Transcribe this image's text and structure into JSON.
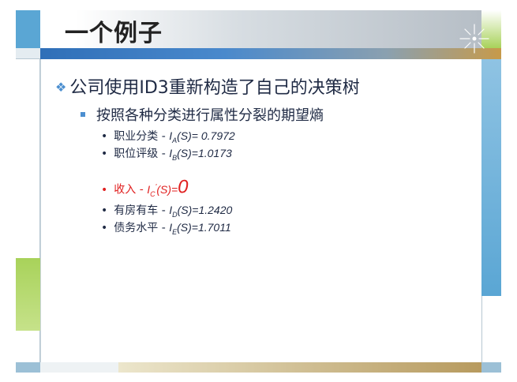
{
  "slide": {
    "title": "一个例子",
    "bullet_1": "公司使用ID3重新构造了自己的决策树",
    "bullet_2": "按照各种分类进行属性分裂的期望熵",
    "items": [
      {
        "label": "职业分类 - ",
        "func": "I",
        "sub": "A",
        "rest": "(S)= 0.7972"
      },
      {
        "label": "职位评级 - ",
        "func": "I",
        "sub": "B",
        "rest": "(S)=1.0173"
      },
      {
        "label": "收入 - ",
        "func": "I",
        "sub": "C",
        "sup": "'",
        "rest": "(S)=",
        "value": "0"
      },
      {
        "label": "有房有车 - ",
        "func": "I",
        "sub": "D",
        "rest": "(S)=1.2420"
      },
      {
        "label": "债务水平 - ",
        "func": "I",
        "sub": "E",
        "rest": "(S)=1.7011"
      }
    ]
  },
  "colors": {
    "accent_blue": "#5aa6d4",
    "accent_green": "#a8d25a",
    "highlight_red": "#e02020",
    "text": "#1f2a44"
  },
  "icons": [
    "diamond-bullet-icon",
    "square-bullet-icon",
    "sunburst-decoration-icon"
  ]
}
